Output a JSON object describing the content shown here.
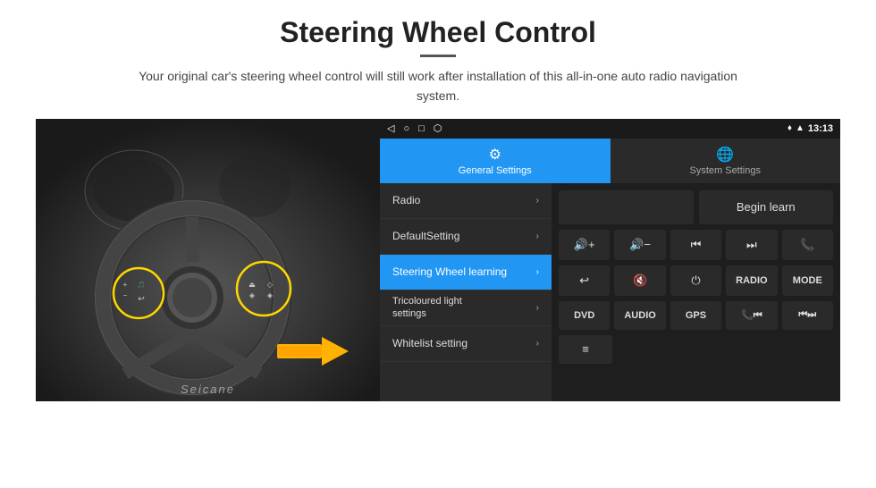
{
  "header": {
    "title": "Steering Wheel Control",
    "subtitle": "Your original car's steering wheel control will still work after installation of this all-in-one auto radio navigation system."
  },
  "status_bar": {
    "time": "13:13",
    "icons": [
      "◁",
      "○",
      "□",
      "⬡"
    ]
  },
  "tabs": [
    {
      "label": "General Settings",
      "icon": "⚙",
      "active": true
    },
    {
      "label": "System Settings",
      "icon": "🌐",
      "active": false
    }
  ],
  "menu": {
    "items": [
      {
        "label": "Radio",
        "active": false
      },
      {
        "label": "DefaultSetting",
        "active": false
      },
      {
        "label": "Steering Wheel learning",
        "active": true
      },
      {
        "label": "Tricoloured light settings",
        "active": false
      },
      {
        "label": "Whitelist setting",
        "active": false
      }
    ]
  },
  "controls": {
    "begin_learn": "Begin learn",
    "buttons_row1": [
      "🔊+",
      "🔊-",
      "⏮",
      "⏭",
      "📞"
    ],
    "buttons_row2": [
      "↩",
      "🔇",
      "⏻",
      "RADIO",
      "MODE"
    ],
    "buttons_row3": [
      "DVD",
      "AUDIO",
      "GPS",
      "📞⏮",
      "⏮⏭"
    ],
    "buttons_row4": [
      "≡"
    ]
  },
  "watermark": "Seicane"
}
